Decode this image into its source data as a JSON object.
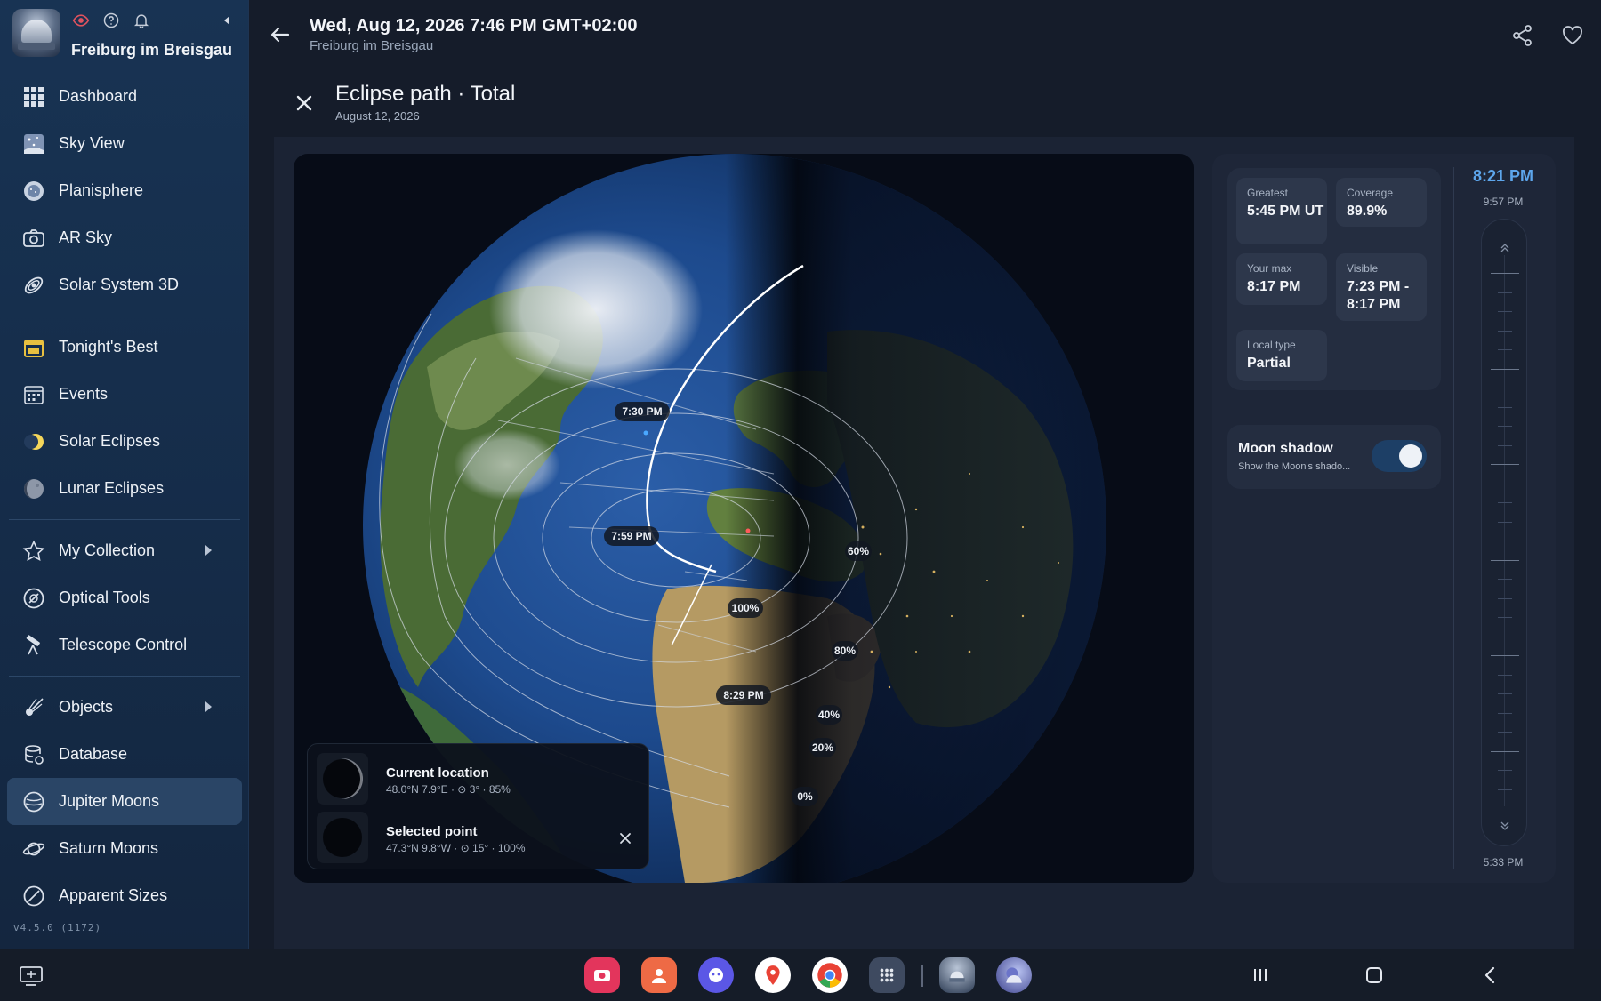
{
  "header": {
    "city": "Freiburg im Breisgau"
  },
  "nav": {
    "group1": [
      {
        "label": "Dashboard",
        "icon": "grid-icon"
      },
      {
        "label": "Sky View",
        "icon": "sky-icon"
      },
      {
        "label": "Planisphere",
        "icon": "planisphere-icon"
      },
      {
        "label": "AR Sky",
        "icon": "camera-icon"
      },
      {
        "label": "Solar System 3D",
        "icon": "orbit-icon"
      }
    ],
    "group2": [
      {
        "label": "Tonight's Best",
        "icon": "calendar-icon"
      },
      {
        "label": "Events",
        "icon": "events-icon"
      },
      {
        "label": "Solar Eclipses",
        "icon": "sun-icon"
      },
      {
        "label": "Lunar Eclipses",
        "icon": "moon-icon"
      }
    ],
    "group3": [
      {
        "label": "My Collection",
        "icon": "star-icon"
      },
      {
        "label": "Optical Tools",
        "icon": "lens-icon"
      },
      {
        "label": "Telescope Control",
        "icon": "telescope-icon"
      }
    ],
    "group4": [
      {
        "label": "Objects",
        "icon": "comet-icon"
      },
      {
        "label": "Database",
        "icon": "database-icon"
      },
      {
        "label": "Jupiter Moons",
        "icon": "jupiter-icon"
      },
      {
        "label": "Saturn Moons",
        "icon": "saturn-icon"
      },
      {
        "label": "Apparent Sizes",
        "icon": "size-icon"
      }
    ],
    "active": "Jupiter Moons",
    "version": "v4.5.0 (1172)"
  },
  "topbar": {
    "datetime": "Wed, Aug 12, 2026 7:46 PM GMT+02:00",
    "location": "Freiburg im Breisgau"
  },
  "panel": {
    "title": "Eclipse path · Total",
    "date": "August 12, 2026"
  },
  "map": {
    "time_labels": [
      "7:30 PM",
      "7:59 PM",
      "8:29 PM"
    ],
    "coverage_labels": [
      "100%",
      "80%",
      "60%",
      "40%",
      "20%",
      "0%"
    ]
  },
  "info": {
    "current": {
      "title": "Current location",
      "sub": "48.0°N  7.9°E · ⊙ 3° · 85%"
    },
    "selected": {
      "title": "Selected point",
      "sub": "47.3°N  9.8°W · ⊙ 15° · 100%"
    }
  },
  "stats": {
    "greatest_label": "Greatest",
    "greatest_value": "5:45 PM UT",
    "coverage_label": "Coverage",
    "coverage_value": "89.9%",
    "yourmax_label": "Your max",
    "yourmax_value": "8:17 PM",
    "visible_label": "Visible",
    "visible_value": "7:23 PM - 8:17 PM",
    "localtype_label": "Local type",
    "localtype_value": "Partial"
  },
  "shadow": {
    "title": "Moon shadow",
    "subtitle": "Show the Moon's shado...",
    "enabled": true
  },
  "timeline": {
    "current": "8:21 PM",
    "top": "9:57 PM",
    "bottom": "5:33 PM"
  },
  "colors": {
    "accent": "#5da6ec",
    "sidebar_bg": "#183353",
    "active_item": "#2a4566"
  }
}
